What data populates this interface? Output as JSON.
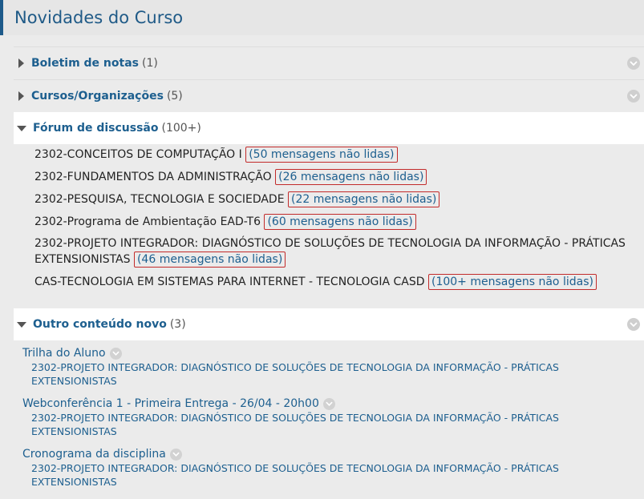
{
  "header": {
    "title": "Novidades do Curso"
  },
  "sections": {
    "grades": {
      "title": "Boletim de notas",
      "count": "(1)"
    },
    "courses": {
      "title": "Cursos/Organizações",
      "count": "(5)"
    },
    "forum": {
      "title": "Fórum de discussão",
      "count": "(100+)",
      "items": [
        {
          "name": "2302-CONCEITOS DE COMPUTAÇÃO I",
          "unread": "(50 mensagens não lidas)"
        },
        {
          "name": "2302-FUNDAMENTOS DA ADMINISTRAÇÃO",
          "unread": "(26 mensagens não lidas)"
        },
        {
          "name": "2302-PESQUISA, TECNOLOGIA E SOCIEDADE",
          "unread": "(22 mensagens não lidas)"
        },
        {
          "name": "2302-Programa de Ambientação EAD-T6",
          "unread": "(60 mensagens não lidas)"
        },
        {
          "name": "2302-PROJETO INTEGRADOR: DIAGNÓSTICO DE SOLUÇÕES DE TECNOLOGIA DA INFORMAÇÃO - PRÁTICAS EXTENSIONISTAS",
          "unread": "(46 mensagens não lidas)"
        },
        {
          "name": "CAS-TECNOLOGIA EM SISTEMAS PARA INTERNET - TECNOLOGIA CASD",
          "unread": "(100+ mensagens não lidas)"
        }
      ]
    },
    "other": {
      "title": "Outro conteúdo novo",
      "count": "(3)",
      "items": [
        {
          "title": "Trilha do Aluno",
          "course": "2302-PROJETO INTEGRADOR: DIAGNÓSTICO DE SOLUÇÕES DE TECNOLOGIA DA INFORMAÇÃO - PRÁTICAS EXTENSIONISTAS"
        },
        {
          "title": "Webconferência 1 - Primeira Entrega - 26/04 - 20h00",
          "course": "2302-PROJETO INTEGRADOR: DIAGNÓSTICO DE SOLUÇÕES DE TECNOLOGIA DA INFORMAÇÃO - PRÁTICAS EXTENSIONISTAS"
        },
        {
          "title": "Cronograma da disciplina",
          "course": "2302-PROJETO INTEGRADOR: DIAGNÓSTICO DE SOLUÇÕES DE TECNOLOGIA DA INFORMAÇÃO - PRÁTICAS EXTENSIONISTAS"
        }
      ]
    }
  },
  "colors": {
    "accent": "#1d5f8f",
    "badge_border": "#c22b2b",
    "header_bar": "#1d5a8a"
  },
  "icons": {
    "collapsed": "caret-right-icon",
    "expanded": "caret-down-icon",
    "options": "chevron-down-icon"
  }
}
